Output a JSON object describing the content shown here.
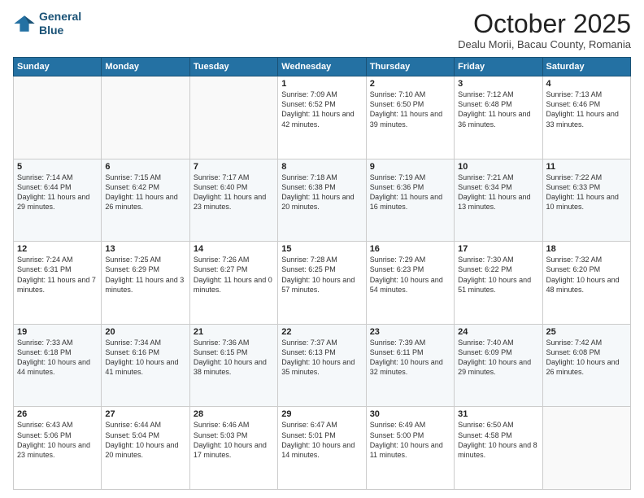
{
  "header": {
    "logo_line1": "General",
    "logo_line2": "Blue",
    "month": "October 2025",
    "location": "Dealu Morii, Bacau County, Romania"
  },
  "weekdays": [
    "Sunday",
    "Monday",
    "Tuesday",
    "Wednesday",
    "Thursday",
    "Friday",
    "Saturday"
  ],
  "weeks": [
    [
      {
        "day": "",
        "info": ""
      },
      {
        "day": "",
        "info": ""
      },
      {
        "day": "",
        "info": ""
      },
      {
        "day": "1",
        "info": "Sunrise: 7:09 AM\nSunset: 6:52 PM\nDaylight: 11 hours and 42 minutes."
      },
      {
        "day": "2",
        "info": "Sunrise: 7:10 AM\nSunset: 6:50 PM\nDaylight: 11 hours and 39 minutes."
      },
      {
        "day": "3",
        "info": "Sunrise: 7:12 AM\nSunset: 6:48 PM\nDaylight: 11 hours and 36 minutes."
      },
      {
        "day": "4",
        "info": "Sunrise: 7:13 AM\nSunset: 6:46 PM\nDaylight: 11 hours and 33 minutes."
      }
    ],
    [
      {
        "day": "5",
        "info": "Sunrise: 7:14 AM\nSunset: 6:44 PM\nDaylight: 11 hours and 29 minutes."
      },
      {
        "day": "6",
        "info": "Sunrise: 7:15 AM\nSunset: 6:42 PM\nDaylight: 11 hours and 26 minutes."
      },
      {
        "day": "7",
        "info": "Sunrise: 7:17 AM\nSunset: 6:40 PM\nDaylight: 11 hours and 23 minutes."
      },
      {
        "day": "8",
        "info": "Sunrise: 7:18 AM\nSunset: 6:38 PM\nDaylight: 11 hours and 20 minutes."
      },
      {
        "day": "9",
        "info": "Sunrise: 7:19 AM\nSunset: 6:36 PM\nDaylight: 11 hours and 16 minutes."
      },
      {
        "day": "10",
        "info": "Sunrise: 7:21 AM\nSunset: 6:34 PM\nDaylight: 11 hours and 13 minutes."
      },
      {
        "day": "11",
        "info": "Sunrise: 7:22 AM\nSunset: 6:33 PM\nDaylight: 11 hours and 10 minutes."
      }
    ],
    [
      {
        "day": "12",
        "info": "Sunrise: 7:24 AM\nSunset: 6:31 PM\nDaylight: 11 hours and 7 minutes."
      },
      {
        "day": "13",
        "info": "Sunrise: 7:25 AM\nSunset: 6:29 PM\nDaylight: 11 hours and 3 minutes."
      },
      {
        "day": "14",
        "info": "Sunrise: 7:26 AM\nSunset: 6:27 PM\nDaylight: 11 hours and 0 minutes."
      },
      {
        "day": "15",
        "info": "Sunrise: 7:28 AM\nSunset: 6:25 PM\nDaylight: 10 hours and 57 minutes."
      },
      {
        "day": "16",
        "info": "Sunrise: 7:29 AM\nSunset: 6:23 PM\nDaylight: 10 hours and 54 minutes."
      },
      {
        "day": "17",
        "info": "Sunrise: 7:30 AM\nSunset: 6:22 PM\nDaylight: 10 hours and 51 minutes."
      },
      {
        "day": "18",
        "info": "Sunrise: 7:32 AM\nSunset: 6:20 PM\nDaylight: 10 hours and 48 minutes."
      }
    ],
    [
      {
        "day": "19",
        "info": "Sunrise: 7:33 AM\nSunset: 6:18 PM\nDaylight: 10 hours and 44 minutes."
      },
      {
        "day": "20",
        "info": "Sunrise: 7:34 AM\nSunset: 6:16 PM\nDaylight: 10 hours and 41 minutes."
      },
      {
        "day": "21",
        "info": "Sunrise: 7:36 AM\nSunset: 6:15 PM\nDaylight: 10 hours and 38 minutes."
      },
      {
        "day": "22",
        "info": "Sunrise: 7:37 AM\nSunset: 6:13 PM\nDaylight: 10 hours and 35 minutes."
      },
      {
        "day": "23",
        "info": "Sunrise: 7:39 AM\nSunset: 6:11 PM\nDaylight: 10 hours and 32 minutes."
      },
      {
        "day": "24",
        "info": "Sunrise: 7:40 AM\nSunset: 6:09 PM\nDaylight: 10 hours and 29 minutes."
      },
      {
        "day": "25",
        "info": "Sunrise: 7:42 AM\nSunset: 6:08 PM\nDaylight: 10 hours and 26 minutes."
      }
    ],
    [
      {
        "day": "26",
        "info": "Sunrise: 6:43 AM\nSunset: 5:06 PM\nDaylight: 10 hours and 23 minutes."
      },
      {
        "day": "27",
        "info": "Sunrise: 6:44 AM\nSunset: 5:04 PM\nDaylight: 10 hours and 20 minutes."
      },
      {
        "day": "28",
        "info": "Sunrise: 6:46 AM\nSunset: 5:03 PM\nDaylight: 10 hours and 17 minutes."
      },
      {
        "day": "29",
        "info": "Sunrise: 6:47 AM\nSunset: 5:01 PM\nDaylight: 10 hours and 14 minutes."
      },
      {
        "day": "30",
        "info": "Sunrise: 6:49 AM\nSunset: 5:00 PM\nDaylight: 10 hours and 11 minutes."
      },
      {
        "day": "31",
        "info": "Sunrise: 6:50 AM\nSunset: 4:58 PM\nDaylight: 10 hours and 8 minutes."
      },
      {
        "day": "",
        "info": ""
      }
    ]
  ]
}
